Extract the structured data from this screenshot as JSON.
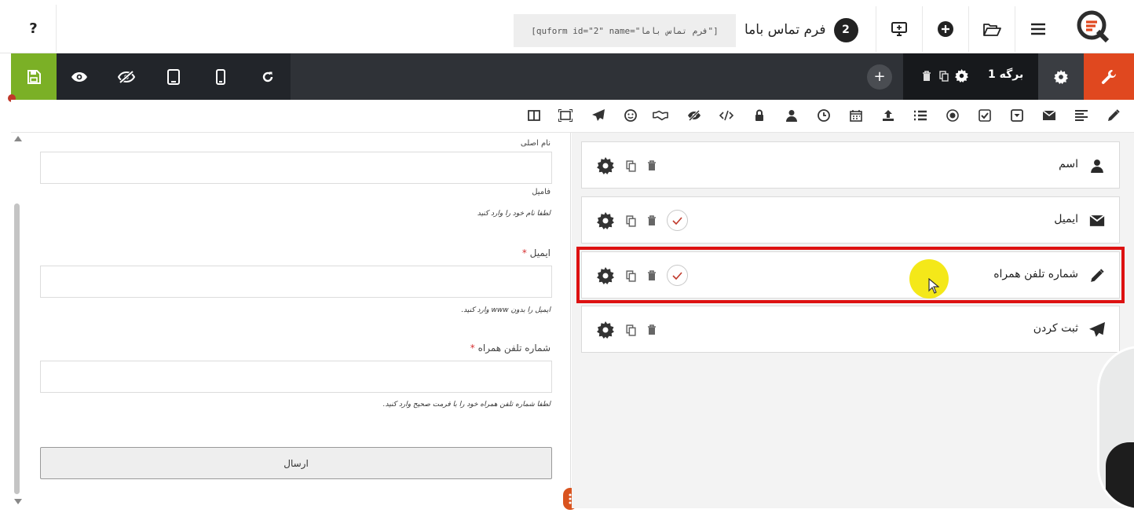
{
  "topbar": {
    "help_label": "?",
    "shortcode": "[quform id=\"2\" name=\"فرم تماس باما\"]",
    "form_number": "2",
    "form_name": "فرم تماس باما"
  },
  "toolbar": {
    "page_label": "برگه 1",
    "add_page_label": "+"
  },
  "preview": {
    "fields": [
      {
        "label": "نام اصلی",
        "sub_label": "فامیل",
        "hint": "لطفا نام خود را وارد کنید"
      },
      {
        "label": "ایمیل",
        "required": "*",
        "hint": "ایمیل را بدون www وارد کنید."
      },
      {
        "label": "شماره تلفن همراه",
        "required": "*",
        "hint": "لطفا شماره تلفن همراه خود را با فرمت صحیح وارد کنید."
      }
    ],
    "submit_label": "ارسال"
  },
  "builder": {
    "rows": [
      {
        "name": "اسم",
        "icon": "user-icon",
        "has_check": false
      },
      {
        "name": "ایمیل",
        "icon": "envelope-icon",
        "has_check": true
      },
      {
        "name": "شماره تلفن همراه",
        "icon": "pencil-icon",
        "has_check": true,
        "selected": true
      },
      {
        "name": "ثبت کردن",
        "icon": "paper-plane-icon",
        "has_check": false
      }
    ]
  },
  "colors": {
    "save_green": "#7bb026",
    "accent_orange": "#e0481f",
    "dark_toolbar": "#2f3237",
    "selection_red": "#dd1111"
  }
}
